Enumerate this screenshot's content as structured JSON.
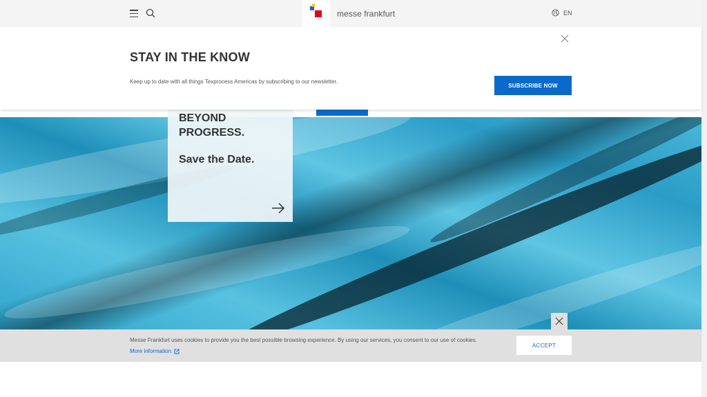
{
  "header": {
    "logo_text": "messe frankfurt",
    "language": "EN"
  },
  "newsletter": {
    "title": "STAY IN THE KNOW",
    "text": "Keep up to date with all things Texprocess Americas by subscribing to our newsletter.",
    "button_label": "SUBSCRIBE NOW"
  },
  "hero": {
    "headline_line1": "BEYOND",
    "headline_line2": "PROGRESS.",
    "subline": "Save the Date."
  },
  "cookie": {
    "text": "Messe Frankfurt uses cookies to provide you the best possible browsing experience. By using our services, you consent to our use of cookies.",
    "link_label": "More information",
    "accept_label": "ACCEPT"
  },
  "colors": {
    "accent": "#0a6acb",
    "logo_red": "#e1001a",
    "logo_blue": "#1b63c7",
    "logo_yellow": "#f2c300"
  }
}
